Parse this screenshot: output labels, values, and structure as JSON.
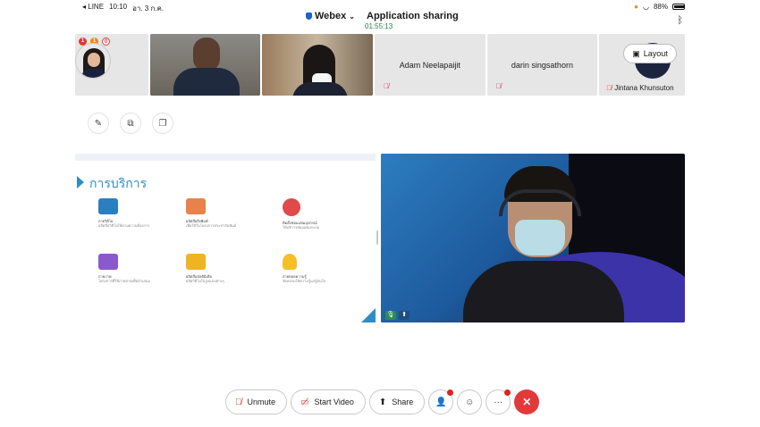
{
  "status_bar": {
    "carrier": "◂ LINE",
    "time": "10:10",
    "date": "อา. 3 ก.ค.",
    "battery": "88%"
  },
  "header": {
    "app_name": "Webex",
    "title": "Application sharing",
    "timer": "01:55:13"
  },
  "participants": [
    {
      "type": "avatar",
      "name": ""
    },
    {
      "type": "video",
      "name": ""
    },
    {
      "type": "video",
      "name": ""
    },
    {
      "type": "name",
      "name": "Adam Neelapaijit"
    },
    {
      "type": "name",
      "name": "darin singsathorn"
    },
    {
      "type": "avatar-name",
      "name": "Jintana Khunsuton"
    }
  ],
  "badges": [
    "1",
    "1",
    "0"
  ],
  "layout_button": {
    "label": "Layout"
  },
  "shared_slide": {
    "title": "การบริการ",
    "services": [
      {
        "line1": "ถ่ายวิดีโอ",
        "line2": "ผลิตสื่อวิดีโอให้ตามความต้องการ",
        "color": "#2c7fbf"
      },
      {
        "line1": "ผลิตสื่อสิ่งพิมพ์",
        "line2": "เพื่อใช้ในโครงการประชาสัมพันธ์",
        "color": "#e8824a"
      },
      {
        "line1": "ติดตั้งซ่อมแซมอุปกรณ์",
        "line2": "ให้บริการซ่อมแซมระบบ",
        "color": "#e04a4a"
      },
      {
        "line1": "ถ่ายภาพ",
        "line2": "โครงการที่ใช้ภาพถ่ายเพื่อนำเสนอ",
        "color": "#8a5acc"
      },
      {
        "line1": "ผลิตสื่อมัลติมีเดีย",
        "line2": "ผลิตวิดีโอในรูปแบบต่างๆ",
        "color": "#f0b323"
      },
      {
        "line1": "ถ่ายทอดความรู้",
        "line2": "จัดอบรมให้ความรู้แก่ผู้สนใจ",
        "color": "#f5c026"
      }
    ]
  },
  "controls": {
    "unmute": "Unmute",
    "start_video": "Start Video",
    "share": "Share"
  },
  "colors": {
    "accent": "#2d8ec9",
    "end_call": "#e23a3a",
    "mute_red": "#d23a3a",
    "timer_green": "#2a7d4f"
  }
}
